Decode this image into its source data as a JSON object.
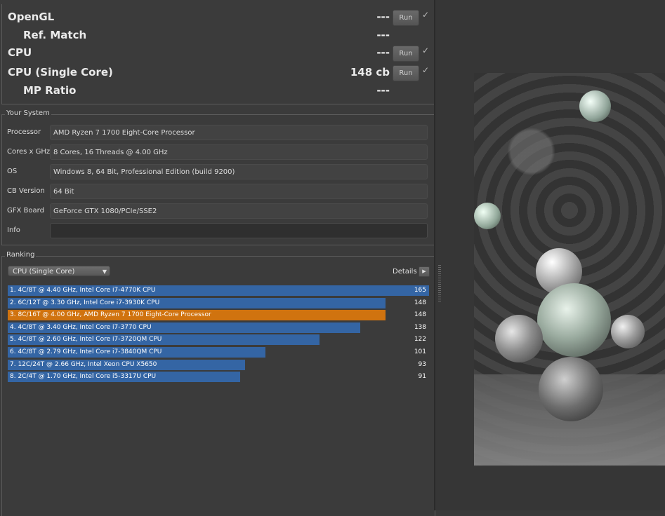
{
  "benchmarks": [
    {
      "label": "OpenGL",
      "score": "---",
      "run_label": "Run",
      "check": "✓",
      "sub": false
    },
    {
      "label": "Ref. Match",
      "score": "---",
      "sub": true
    },
    {
      "label": "CPU",
      "score": "---",
      "run_label": "Run",
      "check": "✓",
      "sub": false
    },
    {
      "label": "CPU (Single Core)",
      "score": "148 cb",
      "run_label": "Run",
      "check": "✓",
      "sub": false
    },
    {
      "label": "MP Ratio",
      "score": "---",
      "sub": true
    }
  ],
  "your_system": {
    "title": "Your System",
    "rows": [
      {
        "label": "Processor",
        "value": "AMD Ryzen 7 1700 Eight-Core Processor"
      },
      {
        "label": "Cores x GHz",
        "value": "8 Cores, 16 Threads @ 4.00 GHz"
      },
      {
        "label": "OS",
        "value": "Windows 8, 64 Bit, Professional Edition (build 9200)"
      },
      {
        "label": "CB Version",
        "value": "64 Bit"
      },
      {
        "label": "GFX Board",
        "value": "GeForce GTX 1080/PCIe/SSE2"
      },
      {
        "label": "Info",
        "value": ""
      }
    ]
  },
  "ranking": {
    "title": "Ranking",
    "selected": "CPU (Single Core)",
    "details_label": "Details",
    "max_score": 165,
    "entries": [
      {
        "label": "1. 4C/8T @ 4.40 GHz, Intel Core i7-4770K CPU",
        "score": 165,
        "highlight": false
      },
      {
        "label": "2. 6C/12T @ 3.30 GHz,  Intel Core i7-3930K CPU",
        "score": 148,
        "highlight": false
      },
      {
        "label": "3. 8C/16T @ 4.00 GHz, AMD Ryzen 7 1700 Eight-Core Processor",
        "score": 148,
        "highlight": true
      },
      {
        "label": "4. 4C/8T @ 3.40 GHz,  Intel Core i7-3770 CPU",
        "score": 138,
        "highlight": false
      },
      {
        "label": "5. 4C/8T @ 2.60 GHz, Intel Core i7-3720QM CPU",
        "score": 122,
        "highlight": false
      },
      {
        "label": "6. 4C/8T @ 2.79 GHz,  Intel Core i7-3840QM CPU",
        "score": 101,
        "highlight": false
      },
      {
        "label": "7. 12C/24T @ 2.66 GHz, Intel Xeon CPU X5650",
        "score": 93,
        "highlight": false
      },
      {
        "label": "8. 2C/4T @ 1.70 GHz,  Intel Core i5-3317U CPU",
        "score": 91,
        "highlight": false
      }
    ]
  },
  "colors": {
    "bar_blue": "#3465a4",
    "bar_highlight": "#d0730f",
    "background": "#3b3b3b"
  }
}
